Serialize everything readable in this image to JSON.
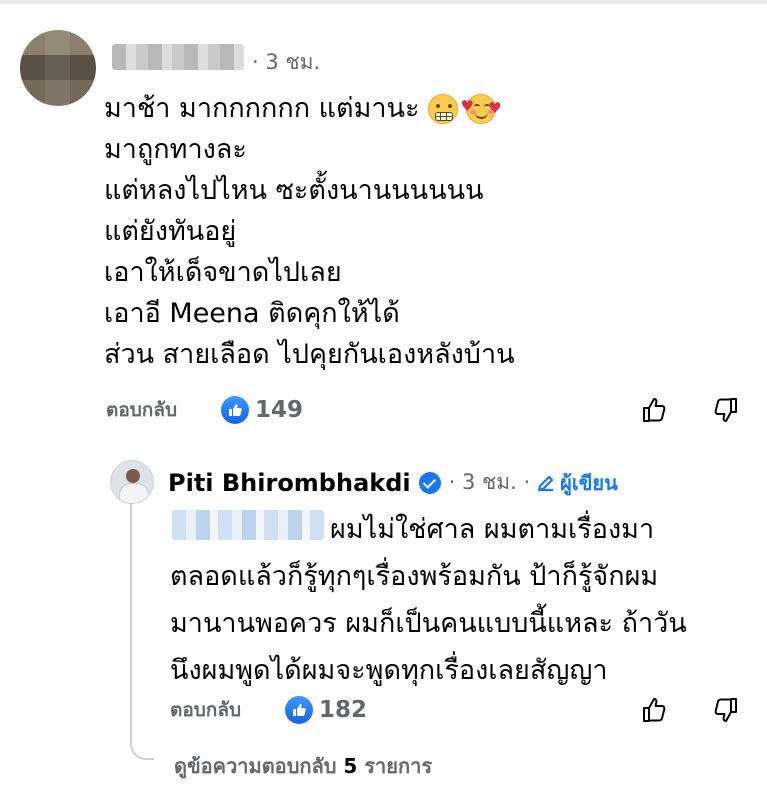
{
  "comment1": {
    "time": "· 3 ชม.",
    "lines": [
      "มาช้า มากกกกกก แต่มานะ",
      "มาถูกทางละ",
      "แต่หลงไปไหน ซะตั้งนานนนนนน",
      "แต่ยังทันอยู่",
      "เอาให้เด็จขาดไปเลย",
      "เอาอี Meena ติดคุกให้ได้",
      "ส่วน สายเลือด ไปคุยกันเองหลังบ้าน"
    ],
    "emoji_icons": [
      "grimacing-face-icon",
      "smiling-face-with-hearts-icon"
    ],
    "reply_label": "ตอบกลับ",
    "like_count": "149"
  },
  "reply": {
    "author": "Piti Bhirombhakdi",
    "time": "· 3 ชม. ·",
    "author_badge": "ผู้เขียน",
    "lines": [
      "ผมไม่ใช่ศาล ผมตามเรื่องมา",
      "ตลอดแล้วก็รู้ทุกๆเรื่องพร้อมกัน ป้าก็รู้จักผม",
      "มานานพอควร ผมก็เป็นคนแบบนี้แหละ ถ้าวัน",
      "นึงผมพูดได้ผมจะพูดทุกเรื่องเลยสัญญา"
    ],
    "reply_label": "ตอบกลับ",
    "like_count": "182"
  },
  "view_replies": {
    "prefix": "ดูข้อความตอบกลับ ",
    "count": "5",
    "suffix": " รายการ"
  },
  "colors": {
    "accent": "#1877f2",
    "muted_text": "#65676b",
    "text": "#050505",
    "thread_line": "#ced0d4"
  }
}
